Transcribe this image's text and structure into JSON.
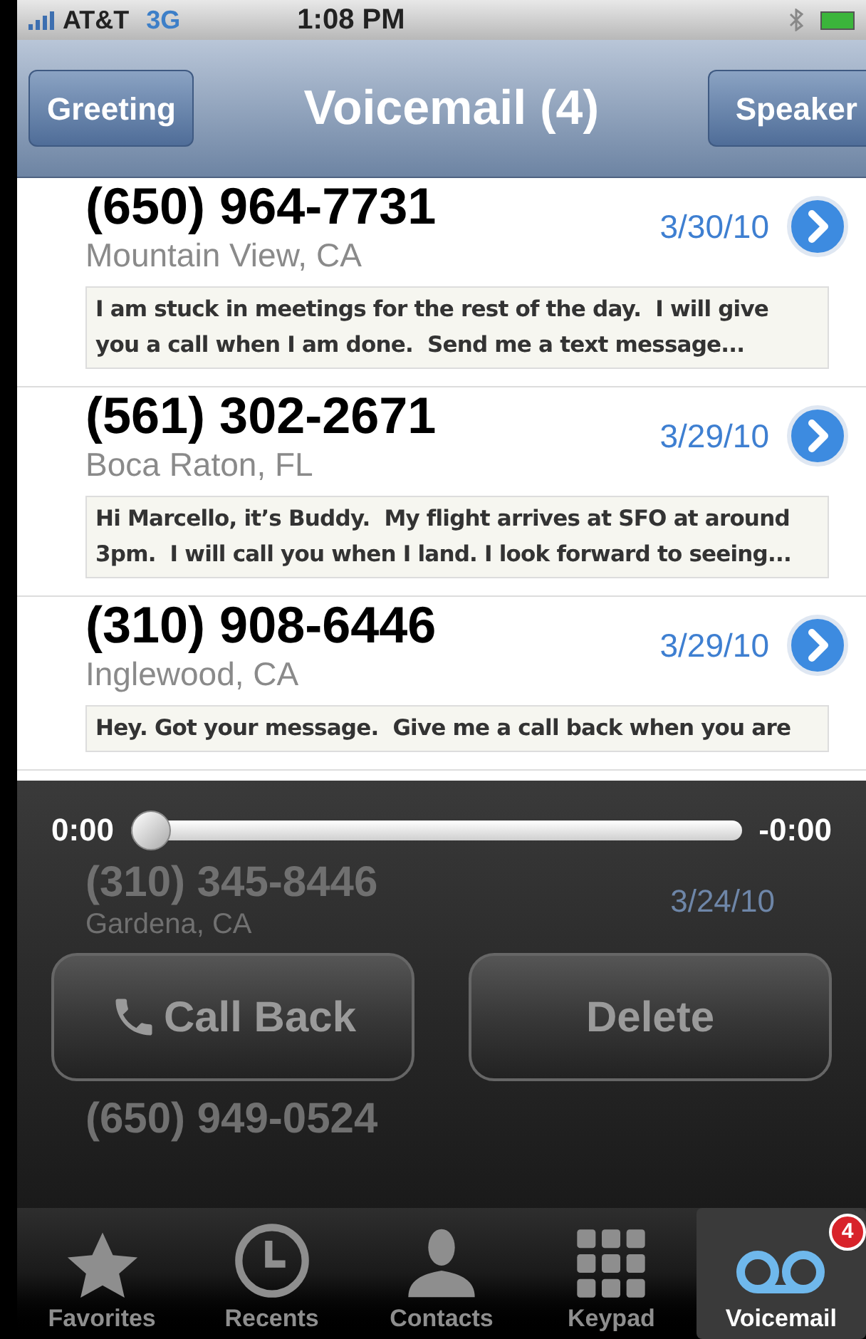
{
  "status_bar": {
    "carrier": "AT&T",
    "network": "3G",
    "time": "1:08 PM"
  },
  "nav": {
    "left_button": "Greeting",
    "title": "Voicemail (4)",
    "right_button": "Speaker"
  },
  "voicemails": [
    {
      "number": "(650) 964-7731",
      "location": "Mountain View, CA",
      "date": "3/30/10",
      "transcript": "I am stuck in meetings for the rest of the day.  I will give you a call when I am done.  Send me a text message..."
    },
    {
      "number": "(561) 302-2671",
      "location": "Boca Raton, FL",
      "date": "3/29/10",
      "transcript": "Hi Marcello, it’s Buddy.  My flight arrives at SFO at around 3pm.  I will call you when I land. I look forward to seeing..."
    },
    {
      "number": "(310) 908-6446",
      "location": "Inglewood, CA",
      "date": "3/29/10",
      "transcript": "Hey. Got your message.  Give me a call back when you are"
    }
  ],
  "dimmed_voicemails": [
    {
      "number": "(310) 345-8446",
      "location": "Gardena, CA",
      "date": "3/24/10"
    },
    {
      "number": "(650) 949-0524"
    }
  ],
  "player": {
    "elapsed": "0:00",
    "remaining": "-0:00",
    "level": 0,
    "buttons": [
      {
        "kind": "call",
        "label": "Call Back"
      },
      {
        "kind": "delete",
        "label": "Delete"
      }
    ]
  },
  "tab_bar": [
    {
      "kind": "star",
      "label": "Favorites",
      "selected": false
    },
    {
      "kind": "clock",
      "label": "Recents",
      "selected": false
    },
    {
      "kind": "person",
      "label": "Contacts",
      "selected": false
    },
    {
      "kind": "keypad",
      "label": "Keypad",
      "selected": false
    },
    {
      "kind": "voicemail",
      "label": "Voicemail",
      "selected": true,
      "badge": "4"
    }
  ]
}
